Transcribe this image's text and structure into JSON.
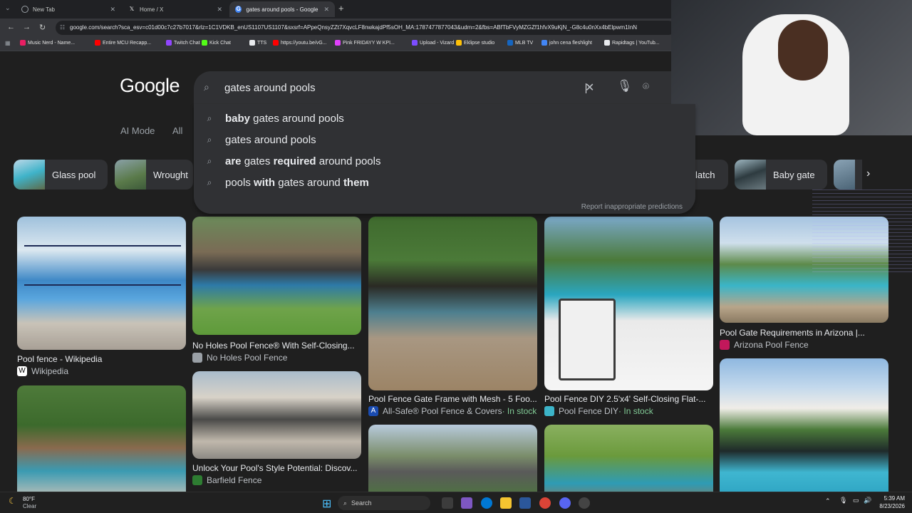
{
  "browser": {
    "tabs": [
      {
        "title": "New Tab",
        "active": false
      },
      {
        "title": "Home / X",
        "active": false
      },
      {
        "title": "gates around pools - Google S",
        "active": true
      }
    ],
    "new_tab_label": "+",
    "url": "google.com/search?sca_esv=c01d00c7c27b7017&rlz=1C1VDKB_enUS1107US1107&sxsrf=APpeQnsyZZt7XqvcLF8nwkajdPf5sOH_MA:1787477877043&udm=2&fbs=ABfTbFVyMZGZf1hfvX9uKjN_-G8c4u0nXx4bElpwm1InN",
    "bookmarks": [
      {
        "label": "Music Nerd - Name...",
        "color": "#e91e63"
      },
      {
        "label": "Entire MCU Recapp...",
        "color": "#ff0000"
      },
      {
        "label": "Twitch Chat",
        "color": "#9146ff"
      },
      {
        "label": "Kick Chat",
        "color": "#53fc18"
      },
      {
        "label": "TTS",
        "color": "#e8eaed"
      },
      {
        "label": "https://youtu.be/vG...",
        "color": "#ff0000"
      },
      {
        "label": "Pink FRIDAYY W KPI...",
        "color": "#e040fb"
      },
      {
        "label": "Upload - Vizard",
        "color": "#7c4dff"
      },
      {
        "label": "Eklipse studio",
        "color": "#ffc107"
      },
      {
        "label": "MLB TV",
        "color": "#1565c0"
      },
      {
        "label": "john cena fleshlight",
        "color": "#4285f4"
      },
      {
        "label": "Rapidtags | YouTub...",
        "color": "#e8eaed"
      }
    ]
  },
  "google": {
    "logo": "Google",
    "query": "gates around pools",
    "suggestions": [
      {
        "pre": "",
        "bold": "baby",
        "mid": " gates around pools",
        "bold2": ""
      },
      {
        "pre": "gates around pools",
        "bold": "",
        "mid": "",
        "bold2": ""
      },
      {
        "pre": "",
        "bold": "are",
        "mid": " gates ",
        "bold2": "required",
        "post": " around pools"
      },
      {
        "pre": "pools ",
        "bold": "with",
        "mid": " gates around ",
        "bold2": "them"
      }
    ],
    "report_label": "Report inappropriate predictions",
    "nav_tabs": [
      "AI Mode",
      "All"
    ],
    "chips": [
      {
        "label": "Glass pool"
      },
      {
        "label": "Wrought"
      },
      {
        "label": "latch"
      },
      {
        "label": "Baby gate"
      }
    ],
    "results": [
      {
        "title": "Pool fence - Wikipedia",
        "source": "Wikipedia",
        "stock": ""
      },
      {
        "title": "No Holes Pool Fence® With Self-Closing...",
        "source": "No Holes Pool Fence",
        "stock": ""
      },
      {
        "title": "Pool Fence Gate Frame with Mesh - 5 Foo...",
        "source": "All-Safe® Pool Fence & Covers",
        "stock": "In stock"
      },
      {
        "title": "Pool Fence DIY 2.5'x4' Self-Closing Flat-...",
        "source": "Pool Fence DIY",
        "stock": "In stock"
      },
      {
        "title": "Pool Gate Requirements in Arizona |...",
        "source": "Arizona Pool Fence",
        "stock": ""
      },
      {
        "title": "Unlock Your Pool's Style Potential: Discov...",
        "source": "Barfield Fence",
        "stock": ""
      }
    ],
    "stock_separator": " · "
  },
  "taskbar": {
    "weather_temp": "80°F",
    "weather_desc": "Clear",
    "search_label": "Search",
    "time": "5:39 AM",
    "date": "8/23/2026"
  }
}
